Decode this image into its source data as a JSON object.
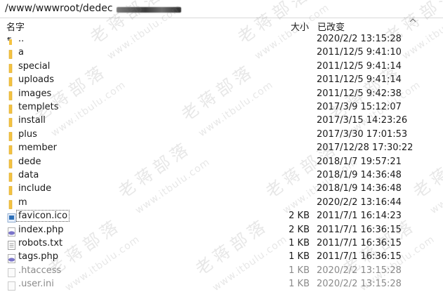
{
  "path": {
    "text": "/www/wwwroot/dedec"
  },
  "columns": {
    "name": "名字",
    "size": "大小",
    "modified": "已改变"
  },
  "files": [
    {
      "name": "..",
      "size": "",
      "date": "2020/2/2 13:15:28",
      "icon": "parent-folder-icon",
      "dim": false
    },
    {
      "name": "a",
      "size": "",
      "date": "2011/12/5 9:41:10",
      "icon": "folder-icon",
      "dim": false
    },
    {
      "name": "special",
      "size": "",
      "date": "2011/12/5 9:41:14",
      "icon": "folder-icon",
      "dim": false
    },
    {
      "name": "uploads",
      "size": "",
      "date": "2011/12/5 9:41:14",
      "icon": "folder-icon",
      "dim": false
    },
    {
      "name": "images",
      "size": "",
      "date": "2011/12/5 9:42:38",
      "icon": "folder-icon",
      "dim": false
    },
    {
      "name": "templets",
      "size": "",
      "date": "2017/3/9 15:12:07",
      "icon": "folder-icon",
      "dim": false
    },
    {
      "name": "install",
      "size": "",
      "date": "2017/3/15 14:23:26",
      "icon": "folder-icon",
      "dim": false
    },
    {
      "name": "plus",
      "size": "",
      "date": "2017/3/30 17:01:53",
      "icon": "folder-icon",
      "dim": false
    },
    {
      "name": "member",
      "size": "",
      "date": "2017/12/28 17:30:22",
      "icon": "folder-icon",
      "dim": false
    },
    {
      "name": "dede",
      "size": "",
      "date": "2018/1/7 19:57:21",
      "icon": "folder-icon",
      "dim": false
    },
    {
      "name": "data",
      "size": "",
      "date": "2018/1/9 14:36:48",
      "icon": "folder-icon",
      "dim": false
    },
    {
      "name": "include",
      "size": "",
      "date": "2018/1/9 14:36:48",
      "icon": "folder-icon",
      "dim": false
    },
    {
      "name": "m",
      "size": "",
      "date": "2020/2/2 13:16:44",
      "icon": "folder-icon",
      "dim": false
    },
    {
      "name": "favicon.ico",
      "size": "2 KB",
      "date": "2011/7/1 16:14:23",
      "icon": "image-file-icon",
      "dim": false
    },
    {
      "name": "index.php",
      "size": "2 KB",
      "date": "2011/7/1 16:36:15",
      "icon": "php-file-icon",
      "dim": false
    },
    {
      "name": "robots.txt",
      "size": "1 KB",
      "date": "2011/7/1 16:36:15",
      "icon": "text-file-icon",
      "dim": false
    },
    {
      "name": "tags.php",
      "size": "1 KB",
      "date": "2011/7/1 16:36:15",
      "icon": "php-file-icon",
      "dim": false
    },
    {
      "name": ".htaccess",
      "size": "1 KB",
      "date": "2020/2/2 13:15:28",
      "icon": "hidden-file-icon",
      "dim": true
    },
    {
      "name": ".user.ini",
      "size": "1 KB",
      "date": "2020/2/2 13:15:28",
      "icon": "hidden-file-icon",
      "dim": true
    }
  ],
  "watermark": {
    "cn": "老蒋部落",
    "url": "www.itbulu.com"
  },
  "colors": {
    "folder": "#f5c342",
    "php": "#7a74c9",
    "ico": "#2d6fb8"
  }
}
